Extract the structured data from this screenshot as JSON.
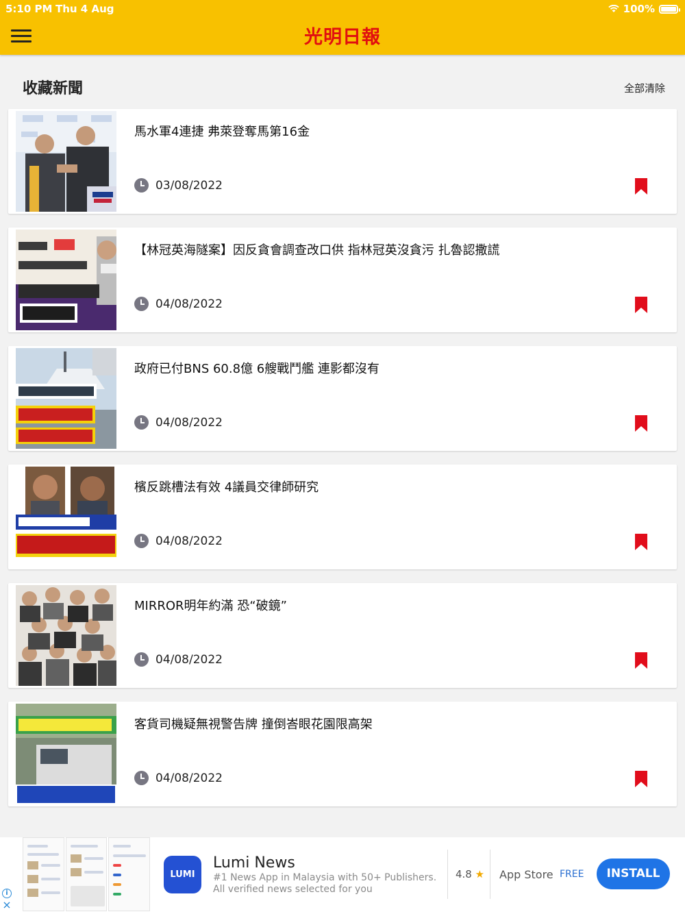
{
  "status_bar": {
    "time": "5:10 PM",
    "date": "Thu 4 Aug",
    "battery": "100%"
  },
  "header": {
    "logo": "光明日報",
    "accent_color": "#f8c100",
    "logo_color": "#e10f0f"
  },
  "section": {
    "title": "收藏新聞",
    "clear_all": "全部清除"
  },
  "articles": [
    {
      "title": "馬水軍4連捷 弗萊登奪馬第16金",
      "date": "03/08/2022",
      "thumb": "sports-photo"
    },
    {
      "title": "【林冠英海隧案】因反貪會調查改口供 指林冠英沒貪污 扎魯認撒謊",
      "date": "04/08/2022",
      "thumb": "news-graphic"
    },
    {
      "title": "政府已付BNS 60.8億 6艘戰鬥艦 連影都沒有",
      "date": "04/08/2022",
      "thumb": "ship-graphic"
    },
    {
      "title": "檳反跳槽法有效 4議員交律師研究",
      "date": "04/08/2022",
      "thumb": "politicians-graphic"
    },
    {
      "title": "MIRROR明年約滿 恐“破鏡”",
      "date": "04/08/2022",
      "thumb": "group-photo"
    },
    {
      "title": "客貨司機疑無視警告牌 撞倒峇眼花園限高架",
      "date": "04/08/2022",
      "thumb": "truck-graphic"
    }
  ],
  "ad": {
    "icon_text": "LUMI",
    "title": "Lumi News",
    "description": "#1 News App in Malaysia with 50+ Publishers. All verified news selected for you",
    "rating": "4.8",
    "star": "★",
    "store": "App Store",
    "price": "FREE",
    "install": "INSTALL"
  }
}
